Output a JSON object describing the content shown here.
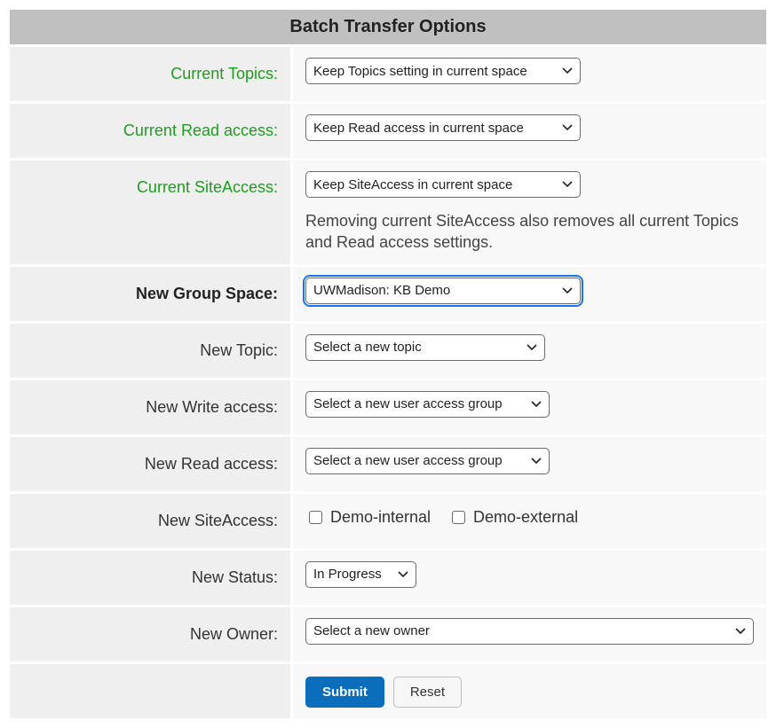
{
  "header": {
    "title": "Batch Transfer Options"
  },
  "rows": {
    "currentTopics": {
      "label": "Current Topics:",
      "selected": "Keep Topics setting in current space"
    },
    "currentReadAccess": {
      "label": "Current Read access:",
      "selected": "Keep Read access in current space"
    },
    "currentSiteAccess": {
      "label": "Current SiteAccess:",
      "selected": "Keep SiteAccess in current space",
      "helper": "Removing current SiteAccess also removes all current Topics and Read access settings."
    },
    "newGroupSpace": {
      "label": "New Group Space:",
      "selected": "UWMadison: KB Demo"
    },
    "newTopic": {
      "label": "New Topic:",
      "selected": "Select a new topic"
    },
    "newWriteAccess": {
      "label": "New Write access:",
      "selected": "Select a new user access group"
    },
    "newReadAccess": {
      "label": "New Read access:",
      "selected": "Select a new user access group"
    },
    "newSiteAccess": {
      "label": "New SiteAccess:",
      "options": [
        {
          "label": "Demo-internal",
          "checked": false
        },
        {
          "label": "Demo-external",
          "checked": false
        }
      ]
    },
    "newStatus": {
      "label": "New Status:",
      "selected": "In Progress"
    },
    "newOwner": {
      "label": "New Owner:",
      "selected": "Select a new owner"
    }
  },
  "buttons": {
    "submit": "Submit",
    "reset": "Reset"
  }
}
